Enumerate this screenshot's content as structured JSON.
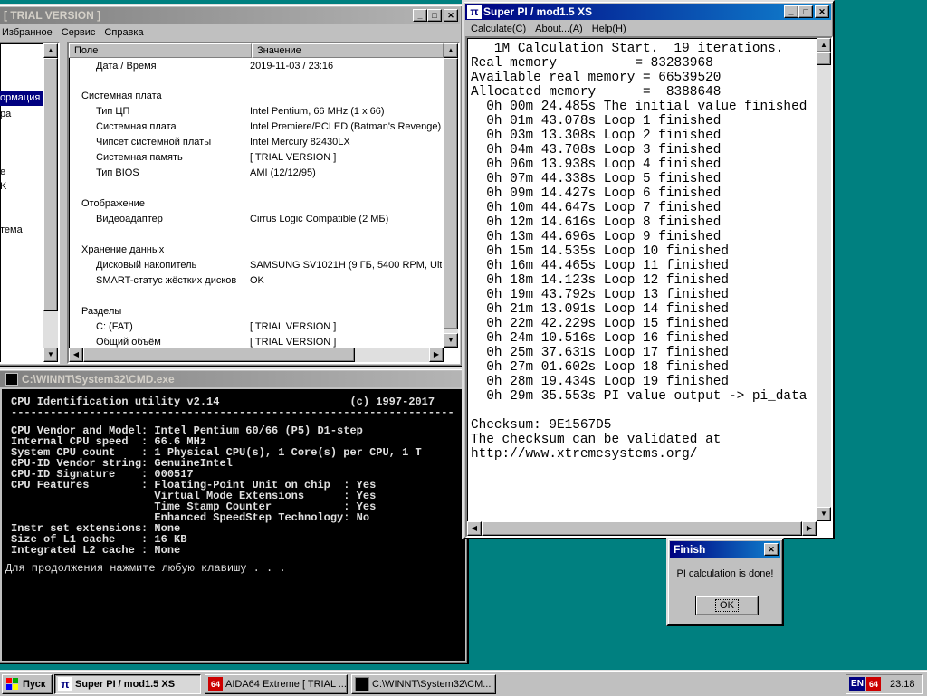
{
  "aida": {
    "title": "[ TRIAL VERSION ]",
    "menu": [
      "Избранное",
      "Сервис",
      "Справка"
    ],
    "tree_items": [
      "ормация",
      "ра",
      "е",
      "K",
      "тема"
    ],
    "columns": [
      "Поле",
      "Значение"
    ],
    "rows": [
      {
        "field": "Дата / Время",
        "value": "2019-11-03 / 23:16"
      },
      {
        "section": "Системная плата"
      },
      {
        "field": "Тип ЦП",
        "value": "Intel Pentium, 66 MHz (1 x 66)"
      },
      {
        "field": "Системная плата",
        "value": "Intel Premiere/PCI ED (Batman's Revenge)"
      },
      {
        "field": "Чипсет системной платы",
        "value": "Intel Mercury 82430LX"
      },
      {
        "field": "Системная память",
        "value": "[ TRIAL VERSION ]"
      },
      {
        "field": "Тип BIOS",
        "value": "AMI (12/12/95)"
      },
      {
        "section": "Отображение"
      },
      {
        "field": "Видеоадаптер",
        "value": "Cirrus Logic Compatible  (2 МБ)"
      },
      {
        "section": "Хранение данных"
      },
      {
        "field": "Дисковый накопитель",
        "value": "SAMSUNG SV1021H  (9 ГБ, 5400 RPM, Ultra"
      },
      {
        "field": "SMART-статус жёстких дисков",
        "value": "OK"
      },
      {
        "section": "Разделы"
      },
      {
        "field": "C: (FAT)",
        "value": "[ TRIAL VERSION ]"
      },
      {
        "field": "Общий объём",
        "value": "[ TRIAL VERSION ]"
      }
    ]
  },
  "cmd": {
    "title": "C:\\WINNT\\System32\\CMD.exe",
    "lines": [
      "CPU Identification utility v2.14                    (c) 1997-2017",
      "--------------------------------------------------------------------",
      "CPU Vendor and Model: Intel Pentium 60/66 (P5) D1-step",
      "Internal CPU speed  : 66.6 MHz",
      "System CPU count    : 1 Physical CPU(s), 1 Core(s) per CPU, 1 T",
      "CPU-ID Vendor string: GenuineIntel",
      "CPU-ID Signature    : 000517",
      "CPU Features        : Floating-Point Unit on chip  : Yes",
      "                      Virtual Mode Extensions      : Yes",
      "                      Time Stamp Counter           : Yes",
      "                      Enhanced SpeedStep Technology: No",
      "Instr set extensions: None",
      "Size of L1 cache    : 16 KB",
      "Integrated L2 cache : None",
      "",
      "Для продолжения нажмите любую клавишу . . ."
    ]
  },
  "superpi": {
    "title": "Super PI / mod1.5 XS",
    "menu": [
      "Calculate(C)",
      "About...(A)",
      "Help(H)"
    ],
    "lines": [
      "   1M Calculation Start.  19 iterations.",
      "Real memory          = 83283968",
      "Available real memory = 66539520",
      "Allocated memory      =  8388648",
      "  0h 00m 24.485s The initial value finished",
      "  0h 01m 43.078s Loop 1 finished",
      "  0h 03m 13.308s Loop 2 finished",
      "  0h 04m 43.708s Loop 3 finished",
      "  0h 06m 13.938s Loop 4 finished",
      "  0h 07m 44.338s Loop 5 finished",
      "  0h 09m 14.427s Loop 6 finished",
      "  0h 10m 44.647s Loop 7 finished",
      "  0h 12m 14.616s Loop 8 finished",
      "  0h 13m 44.696s Loop 9 finished",
      "  0h 15m 14.535s Loop 10 finished",
      "  0h 16m 44.465s Loop 11 finished",
      "  0h 18m 14.123s Loop 12 finished",
      "  0h 19m 43.792s Loop 13 finished",
      "  0h 21m 13.091s Loop 14 finished",
      "  0h 22m 42.229s Loop 15 finished",
      "  0h 24m 10.516s Loop 16 finished",
      "  0h 25m 37.631s Loop 17 finished",
      "  0h 27m 01.602s Loop 18 finished",
      "  0h 28m 19.434s Loop 19 finished",
      "  0h 29m 35.553s PI value output -> pi_data",
      "",
      "Checksum: 9E1567D5",
      "The checksum can be validated at",
      "http://www.xtremesystems.org/"
    ]
  },
  "finish": {
    "title": "Finish",
    "message": "PI calculation is done!",
    "ok": "OK"
  },
  "taskbar": {
    "start": "Пуск",
    "items": [
      "Super PI / mod1.5 XS",
      "AIDA64 Extreme  [ TRIAL ...",
      "C:\\WINNT\\System32\\CM..."
    ],
    "lang": "EN",
    "tray_badge": "64",
    "clock": "23:18"
  }
}
